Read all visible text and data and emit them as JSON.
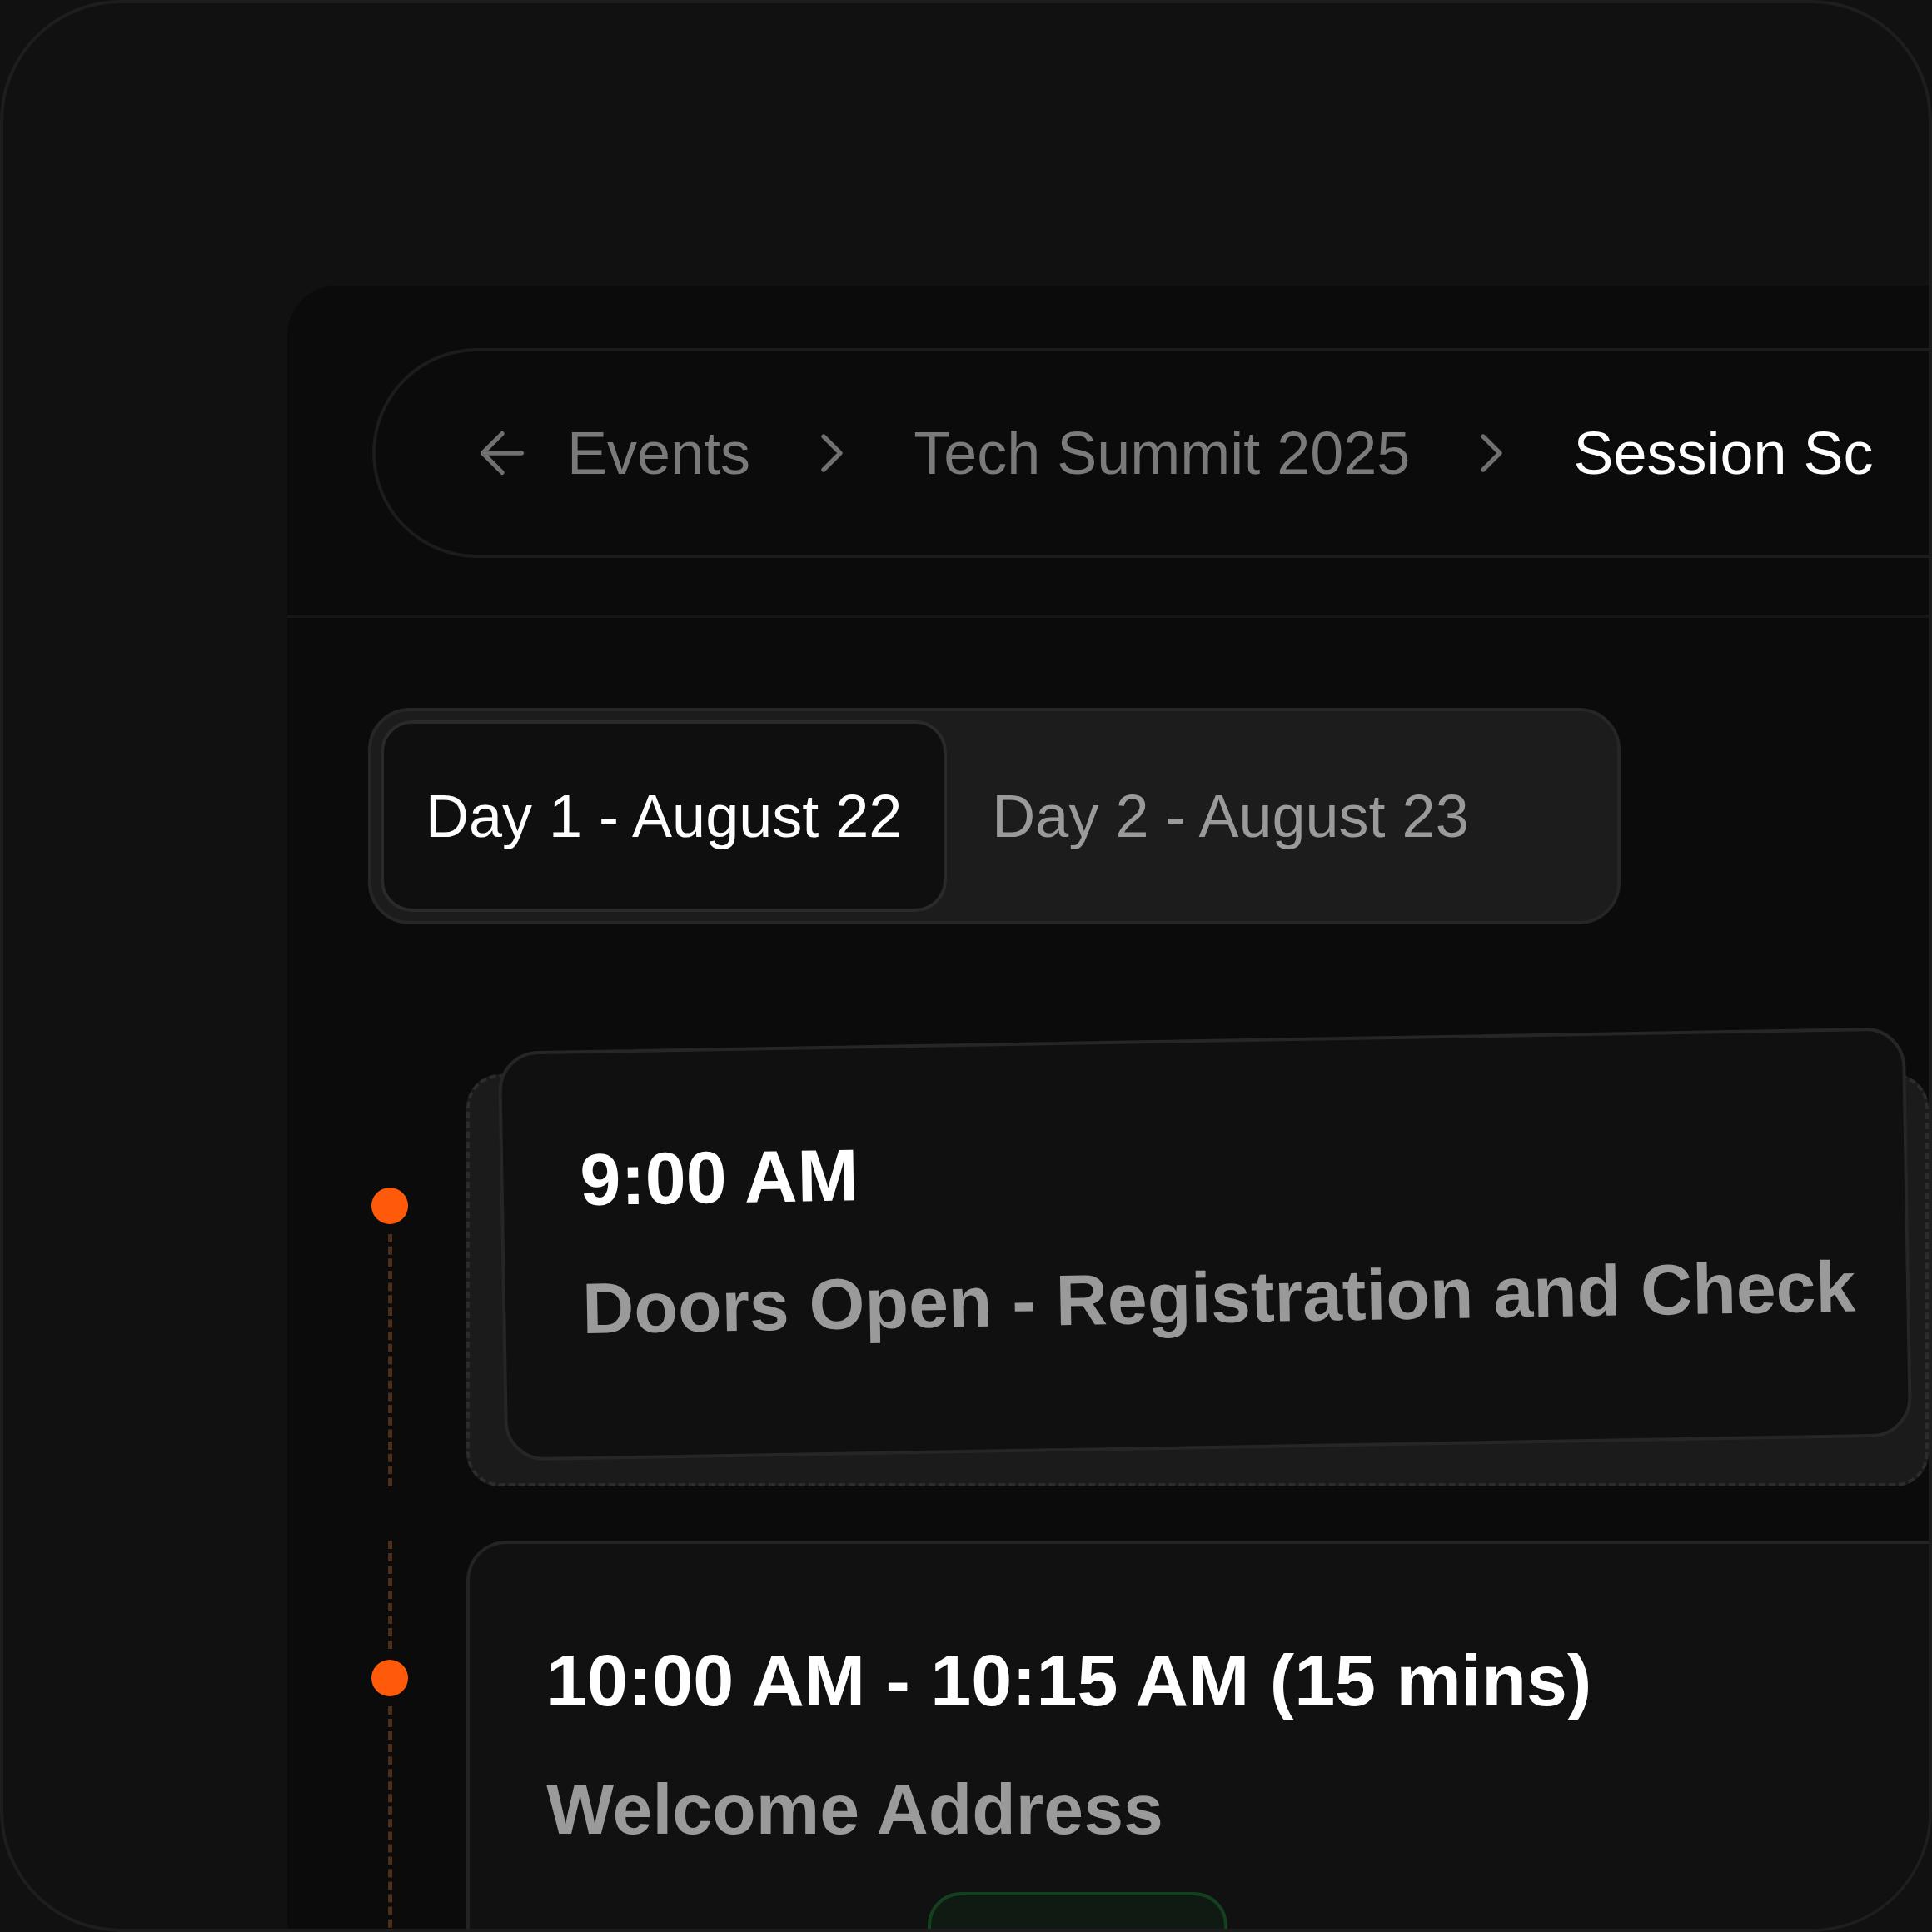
{
  "breadcrumb": {
    "items": [
      {
        "label": "Events",
        "current": false
      },
      {
        "label": "Tech Summit 2025",
        "current": false
      },
      {
        "label": "Session Sc",
        "current": true
      }
    ]
  },
  "day_tabs": [
    {
      "label": "Day 1 - August 22",
      "selected": true
    },
    {
      "label": "Day 2 - August 23",
      "selected": false
    }
  ],
  "sessions": [
    {
      "kind": "tilted",
      "time": "9:00 AM",
      "title": "Doors Open - Registration and Check"
    },
    {
      "kind": "flat",
      "time": "10:00 AM - 10:15 AM (15 mins)",
      "title": "Welcome Address",
      "status_badge": true
    }
  ]
}
